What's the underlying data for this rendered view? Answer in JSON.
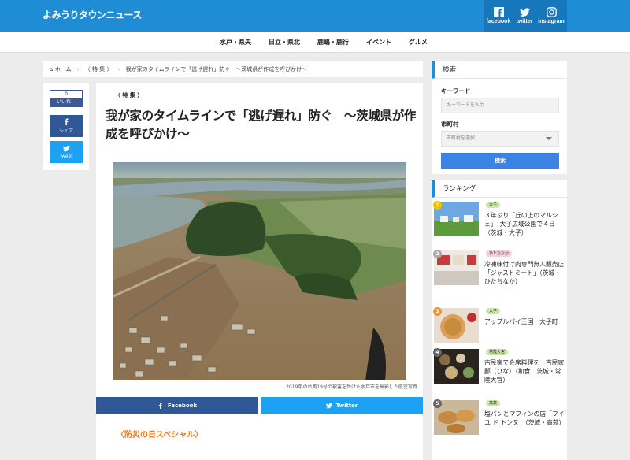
{
  "site": {
    "logo": "よみうりタウンニュース"
  },
  "social": [
    {
      "icon": "facebook-icon",
      "label": "facebook"
    },
    {
      "icon": "twitter-icon",
      "label": "twitter"
    },
    {
      "icon": "instagram-icon",
      "label": "instagram"
    }
  ],
  "nav": [
    "水戸・県央",
    "日立・県北",
    "鹿嶋・鹿行",
    "イベント",
    "グルメ"
  ],
  "breadcrumb": {
    "home": "ホーム",
    "category": "〈 特 集 〉",
    "current": "我が家のタイムラインで「逃げ遅れ」防ぐ　〜茨城県が作成を呼びかけ〜"
  },
  "share_side": {
    "like_count": "0",
    "like_label": "いいね！",
    "share_label": "シェア",
    "tweet_label": "Tweet"
  },
  "article": {
    "tag": "〈 特 集 〉",
    "title": "我が家のタイムラインで「逃げ遅れ」防ぐ　〜茨城県が作成を呼びかけ〜",
    "caption": "2019年の台風19号の被害を受けた水戸市を撮影した航空写真",
    "share_facebook": "Facebook",
    "share_twitter": "Twitter",
    "subhead": "〈防災の日スペシャル〉"
  },
  "search": {
    "heading": "検索",
    "keyword_label": "キーワード",
    "keyword_placeholder": "キーワードを入力",
    "city_label": "市町村",
    "city_selected": "市町村を選択",
    "button": "検索"
  },
  "ranking": {
    "heading": "ランキング",
    "items": [
      {
        "rank": "1",
        "badge": "大子",
        "title": "３年ぶり「丘の上のマルシェ」　大子広域公園で４日（茨城・大子）",
        "rank_color": "#f2c200",
        "badge_color": "#c9e6a8"
      },
      {
        "rank": "2",
        "badge": "ひたちなか",
        "title": "冷凍味付け肉専門無人販売店　「ジャストミート」（茨城・ひたちなか）",
        "rank_color": "#aaaaaa",
        "badge_color": "#f6cfd6"
      },
      {
        "rank": "3",
        "badge": "大子",
        "title": "アップルパイ王国　大子町",
        "rank_color": "#e8963c",
        "badge_color": "#c9e6a8"
      },
      {
        "rank": "4",
        "badge": "常陸大宮",
        "title": "古民家で会席料理を　古民家 鄙（ひな）（和食　茨城・常陸大宮）",
        "rank_color": "#666666",
        "badge_color": "#c9e6a8"
      },
      {
        "rank": "5",
        "badge": "高萩",
        "title": "塩パンとマフィンの店「フイユ ド トンヌ」（茨城・高萩）",
        "rank_color": "#666666",
        "badge_color": "#c9e6a8"
      }
    ]
  }
}
